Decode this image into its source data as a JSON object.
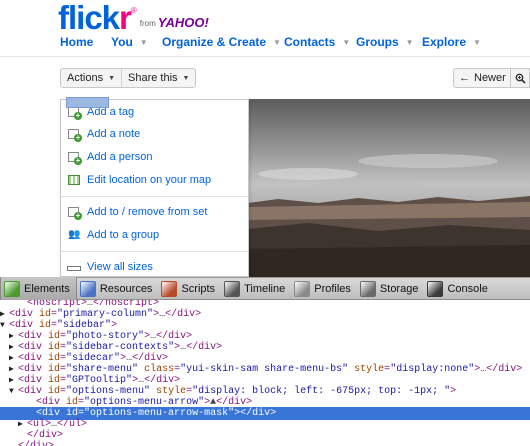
{
  "header": {
    "logo_flick": "flick",
    "logo_r": "r",
    "logo_reg": "®",
    "logo_from": "from",
    "logo_yahoo": "YAHOO!",
    "nav": [
      {
        "label": "Home",
        "caret": false
      },
      {
        "label": "You",
        "caret": true
      },
      {
        "label": "Organize & Create",
        "caret": true
      },
      {
        "label": "Contacts",
        "caret": true
      },
      {
        "label": "Groups",
        "caret": true
      },
      {
        "label": "Explore",
        "caret": true
      }
    ]
  },
  "toolbar": {
    "actions_label": "Actions",
    "share_label": "Share this",
    "newer_label": "Newer",
    "newer_icon": "left-arrow-icon",
    "zoom_icon": "magnifier-icon"
  },
  "actions_menu": {
    "items": [
      {
        "label": "Add a tag",
        "icon": "tag-plus-icon"
      },
      {
        "label": "Add a note",
        "icon": "note-plus-icon"
      },
      {
        "label": "Add a person",
        "icon": "person-plus-icon"
      },
      {
        "label": "Edit location on your map",
        "icon": "map-grid-icon"
      },
      {
        "label": "Add to / remove from set",
        "icon": "set-plus-icon"
      },
      {
        "label": "Add to a group",
        "icon": "group-people-icon"
      },
      {
        "label": "View all sizes",
        "icon": "sizes-icon"
      }
    ]
  },
  "devtools": {
    "tabs": [
      {
        "label": "Elements",
        "icon": "elements-icon",
        "color": "#4a9a2c",
        "active": true
      },
      {
        "label": "Resources",
        "icon": "resources-icon",
        "color": "#4b73c4",
        "active": false
      },
      {
        "label": "Scripts",
        "icon": "scripts-icon",
        "color": "#b84a2a",
        "active": false
      },
      {
        "label": "Timeline",
        "icon": "timeline-icon",
        "color": "#555555",
        "active": false
      },
      {
        "label": "Profiles",
        "icon": "profiles-icon",
        "color": "#8a8a8a",
        "active": false
      },
      {
        "label": "Storage",
        "icon": "storage-icon",
        "color": "#6a6a6a",
        "active": false
      },
      {
        "label": "Console",
        "icon": "console-icon",
        "color": "#3a3a3a",
        "active": false
      }
    ],
    "dom_lines": [
      {
        "arrow": "",
        "indent": 2,
        "tokens": [
          [
            "tg",
            "<noscript>"
          ],
          [
            "tw",
            "…"
          ],
          [
            "tg",
            "</noscript>"
          ]
        ]
      },
      {
        "arrow": "▶",
        "indent": 1,
        "tokens": [
          [
            "tg",
            "<div "
          ],
          [
            "an",
            "id"
          ],
          [
            "tg",
            "="
          ],
          [
            "av",
            "\"primary-column\""
          ],
          [
            "tg",
            ">"
          ],
          [
            "tw",
            "…"
          ],
          [
            "tg",
            "</div>"
          ]
        ]
      },
      {
        "arrow": "▼",
        "indent": 1,
        "tokens": [
          [
            "tg",
            "<div "
          ],
          [
            "an",
            "id"
          ],
          [
            "tg",
            "="
          ],
          [
            "av",
            "\"sidebar\""
          ],
          [
            "tg",
            ">"
          ]
        ]
      },
      {
        "arrow": "▶",
        "indent": 2,
        "tokens": [
          [
            "tg",
            "<div "
          ],
          [
            "an",
            "id"
          ],
          [
            "tg",
            "="
          ],
          [
            "av",
            "\"photo-story\""
          ],
          [
            "tg",
            ">"
          ],
          [
            "tw",
            "…"
          ],
          [
            "tg",
            "</div>"
          ]
        ]
      },
      {
        "arrow": "▶",
        "indent": 2,
        "tokens": [
          [
            "tg",
            "<div "
          ],
          [
            "an",
            "id"
          ],
          [
            "tg",
            "="
          ],
          [
            "av",
            "\"sidebar-contexts\""
          ],
          [
            "tg",
            ">"
          ],
          [
            "tw",
            "…"
          ],
          [
            "tg",
            "</div>"
          ]
        ]
      },
      {
        "arrow": "▶",
        "indent": 2,
        "tokens": [
          [
            "tg",
            "<div "
          ],
          [
            "an",
            "id"
          ],
          [
            "tg",
            "="
          ],
          [
            "av",
            "\"sidecar\""
          ],
          [
            "tg",
            ">"
          ],
          [
            "tw",
            "…"
          ],
          [
            "tg",
            "</div>"
          ]
        ]
      },
      {
        "arrow": "▶",
        "indent": 2,
        "tokens": [
          [
            "tg",
            "<div "
          ],
          [
            "an",
            "id"
          ],
          [
            "tg",
            "="
          ],
          [
            "av",
            "\"share-menu\""
          ],
          [
            "tg",
            " "
          ],
          [
            "an",
            "class"
          ],
          [
            "tg",
            "="
          ],
          [
            "av",
            "\"yui-skin-sam share-menu-bs\""
          ],
          [
            "tg",
            " "
          ],
          [
            "an",
            "style"
          ],
          [
            "tg",
            "="
          ],
          [
            "av",
            "\"display:none\""
          ],
          [
            "tg",
            ">"
          ],
          [
            "tw",
            "…"
          ],
          [
            "tg",
            "</div>"
          ]
        ]
      },
      {
        "arrow": "▶",
        "indent": 2,
        "tokens": [
          [
            "tg",
            "<div "
          ],
          [
            "an",
            "id"
          ],
          [
            "tg",
            "="
          ],
          [
            "av",
            "\"GPTooltip\""
          ],
          [
            "tg",
            ">"
          ],
          [
            "tw",
            "…"
          ],
          [
            "tg",
            "</div>"
          ]
        ]
      },
      {
        "arrow": "▼",
        "indent": 2,
        "tokens": [
          [
            "tg",
            "<div "
          ],
          [
            "an",
            "id"
          ],
          [
            "tg",
            "="
          ],
          [
            "av",
            "\"options-menu\""
          ],
          [
            "tg",
            " "
          ],
          [
            "an",
            "style"
          ],
          [
            "tg",
            "="
          ],
          [
            "av",
            "\"display: block; left: -675px; top: -1px; \""
          ],
          [
            "tg",
            ">"
          ]
        ]
      },
      {
        "arrow": "",
        "indent": 3,
        "tokens": [
          [
            "tg",
            "<div "
          ],
          [
            "an",
            "id"
          ],
          [
            "tg",
            "="
          ],
          [
            "av",
            "\"options-menu-arrow\""
          ],
          [
            "tg",
            ">"
          ],
          [
            "tw",
            "▲"
          ],
          [
            "tg",
            "</div>"
          ]
        ]
      },
      {
        "arrow": "",
        "indent": 3,
        "selected": true,
        "tokens": [
          [
            "tg",
            "<div "
          ],
          [
            "an",
            "id"
          ],
          [
            "tg",
            "="
          ],
          [
            "av",
            "\"options-menu-arrow-mask\""
          ],
          [
            "tg",
            "></div>"
          ]
        ]
      },
      {
        "arrow": "▶",
        "indent": 3,
        "tokens": [
          [
            "tg",
            "<ul>"
          ],
          [
            "tw",
            "…"
          ],
          [
            "tg",
            "</ul>"
          ]
        ]
      },
      {
        "arrow": "",
        "indent": 2,
        "tokens": [
          [
            "tg",
            "</div>"
          ]
        ]
      },
      {
        "arrow": "",
        "indent": 1,
        "tokens": [
          [
            "tg",
            "</div>"
          ]
        ]
      }
    ]
  }
}
